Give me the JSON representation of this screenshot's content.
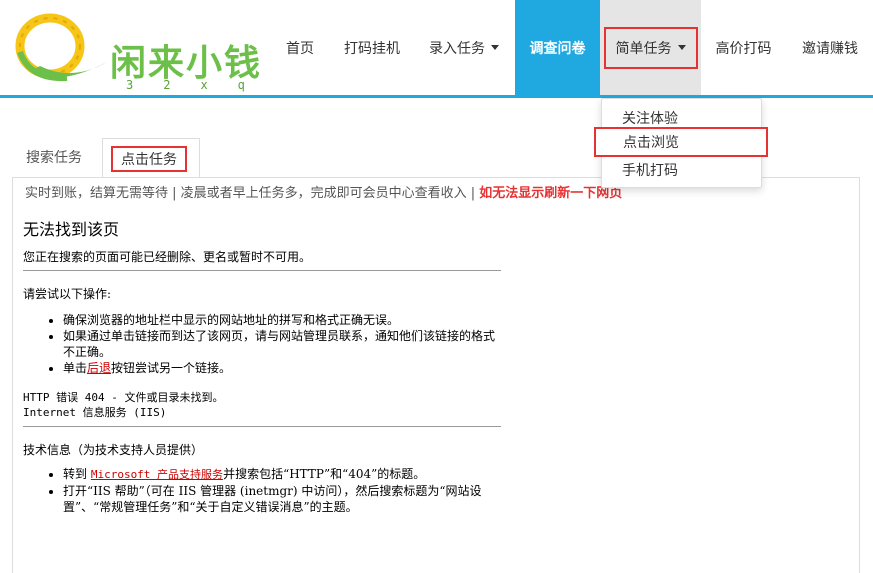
{
  "header": {
    "logo_text": "闲来小钱",
    "logo_sub": "32xq",
    "nav": {
      "home": "首页",
      "guaji": "打码挂机",
      "luru": "录入任务",
      "survey": "调查问卷",
      "simple": "简单任务",
      "gaojia": "高价打码",
      "yaoqing": "邀请赚钱"
    }
  },
  "dropdown": {
    "items": [
      "关注体验",
      "点击浏览",
      "手机打码"
    ]
  },
  "tabs": {
    "search": "搜索任务",
    "click": "点击任务"
  },
  "notice": {
    "text": "实时到账，结算无需等待 | 凌晨或者早上任务多，完成即可会员中心查看收入 | ",
    "red": "如无法显示刷新一下网页"
  },
  "error_page": {
    "title": "无法找到该页",
    "desc": "您正在搜索的页面可能已经删除、更名或暂时不可用。",
    "try_label": "请尝试以下操作:",
    "tips": [
      "确保浏览器的地址栏中显示的网站地址的拼写和格式正确无误。",
      "如果通过单击链接而到达了该网页，请与网站管理员联系，通知他们该链接的格式不正确。"
    ],
    "back_pre": "单击",
    "back_link": "后退",
    "back_post": "按钮尝试另一个链接。",
    "http_error": "HTTP 错误 404 - 文件或目录未找到。",
    "iis": "Internet 信息服务 (IIS)",
    "tech_label": "技术信息（为技术支持人员提供）",
    "goto_pre": "转到 ",
    "goto_link": "Microsoft 产品支持服务",
    "goto_post": "并搜索包括“HTTP”和“404”的标题。",
    "open_help": "打开“IIS 帮助”（可在 IIS 管理器 (inetmgr) 中访问），然后搜索标题为“网站设置”、“常规管理任务”和“关于自定义错误消息”的主题。"
  },
  "colors": {
    "accent_blue": "#20a9e1",
    "highlight_red": "#e53333",
    "logo_green": "#6cc04a",
    "logo_yellow": "#f5c518"
  }
}
